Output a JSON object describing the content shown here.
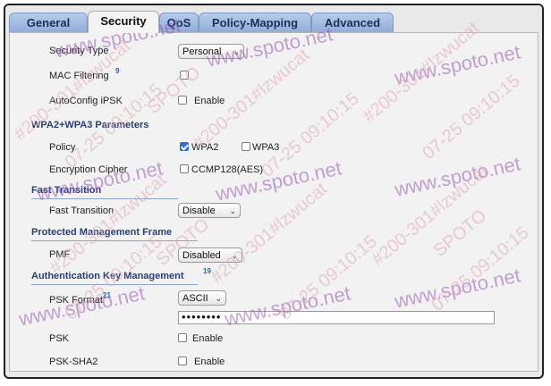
{
  "tabs": [
    {
      "label": "General"
    },
    {
      "label": "Security"
    },
    {
      "label": "QoS"
    },
    {
      "label": "Policy-Mapping"
    },
    {
      "label": "Advanced"
    }
  ],
  "active_tab": "Security",
  "fields": {
    "security_type": {
      "label": "Security Type",
      "value": "Personal"
    },
    "mac_filtering": {
      "label": "MAC Filtering",
      "help": "9",
      "checked": false
    },
    "autoconfig_ipsk": {
      "label": "AutoConfig iPSK",
      "option": "Enable",
      "checked": false
    }
  },
  "wpa_section": {
    "title": "WPA2+WPA3 Parameters",
    "policy": {
      "label": "Policy",
      "wpa2": "WPA2",
      "wpa2_checked": true,
      "wpa3": "WPA3",
      "wpa3_checked": false
    },
    "cipher": {
      "label": "Encryption Cipher",
      "option": "CCMP128(AES)",
      "checked": false
    }
  },
  "ft_section": {
    "title": "Fast Transition",
    "fast_transition": {
      "label": "Fast Transition",
      "value": "Disable"
    }
  },
  "pmf_section": {
    "title": "Protected Management Frame",
    "pmf": {
      "label": "PMF",
      "value": "Disabled"
    }
  },
  "akm_section": {
    "title": "Authentication Key Management",
    "help": "19",
    "psk_format": {
      "label": "PSK Format",
      "help": "21",
      "value": "ASCII"
    },
    "psk_value": "••••••••",
    "psk": {
      "label": "PSK",
      "option": "Enable",
      "checked": false
    },
    "psk_sha2": {
      "label": "PSK-SHA2",
      "option": "Enable",
      "checked": false
    }
  },
  "watermark": {
    "site": "www.spoto.net",
    "id": "#200-301#lzwucat",
    "date": "07-25 09:10:15",
    "brand": "SPOTO"
  }
}
